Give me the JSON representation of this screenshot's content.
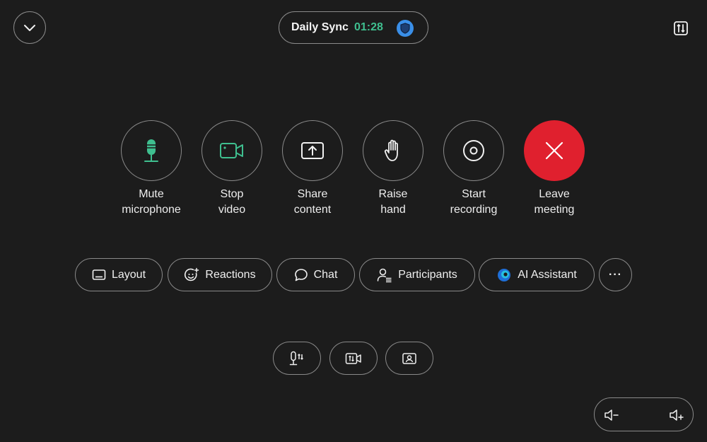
{
  "header": {
    "meeting_name": "Daily Sync",
    "timer": "01:28",
    "timer_color": "#3fbf8f",
    "shield_color": "#3a8fe8",
    "collapse_icon": "chevron-down-icon",
    "settings_icon": "sliders-icon"
  },
  "actions": [
    {
      "label": "Mute\nmicrophone",
      "icon": "microphone-icon"
    },
    {
      "label": "Stop\nvideo",
      "icon": "camera-icon"
    },
    {
      "label": "Share\ncontent",
      "icon": "share-icon"
    },
    {
      "label": "Raise\nhand",
      "icon": "hand-icon"
    },
    {
      "label": "Start\nrecording",
      "icon": "record-icon"
    },
    {
      "label": "Leave\nmeeting",
      "icon": "close-icon"
    }
  ],
  "colors": {
    "accent_green": "#3fbf8f",
    "leave_red": "#e0202e",
    "background": "#1c1c1c"
  },
  "toolbar": {
    "layout_label": "Layout",
    "reactions_label": "Reactions",
    "chat_label": "Chat",
    "participants_label": "Participants",
    "ai_label": "AI Assistant",
    "more_label": "···"
  },
  "device_controls": [
    "microphone-settings-icon",
    "camera-settings-icon",
    "self-view-icon"
  ],
  "volume": [
    "volume-down-icon",
    "volume-up-icon"
  ]
}
